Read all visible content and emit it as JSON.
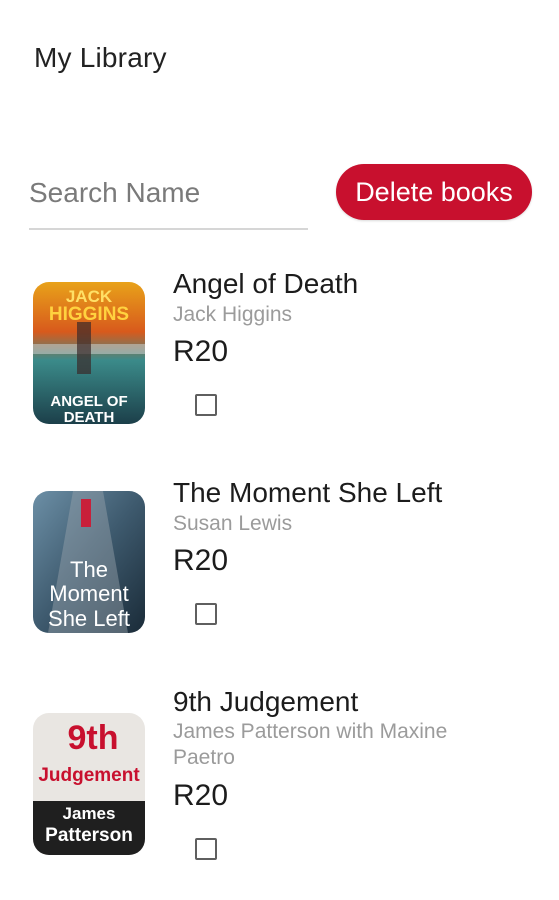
{
  "app": {
    "title": "My Library"
  },
  "search": {
    "placeholder": "Search Name",
    "value": ""
  },
  "actions": {
    "delete_label": "Delete books",
    "accent_color": "#c8102e"
  },
  "books": [
    {
      "title": "Angel of Death",
      "author": "Jack Higgins",
      "price": "R20",
      "checked": false,
      "cover": {
        "line1": "JACK",
        "line2": "HIGGINS",
        "line3": "ANGEL OF",
        "line4": "DEATH"
      }
    },
    {
      "title": "The Moment She Left",
      "author": "Susan Lewis",
      "price": "R20",
      "checked": false,
      "cover": {
        "line1": "The",
        "line2": "Moment",
        "line3": "She Left"
      }
    },
    {
      "title": "9th Judgement",
      "author": "James Patterson with Maxine Paetro",
      "price": "R20",
      "checked": false,
      "cover": {
        "line1": "9th",
        "line2": "Judgement",
        "line3": "James",
        "line4": "Patterson"
      }
    }
  ]
}
